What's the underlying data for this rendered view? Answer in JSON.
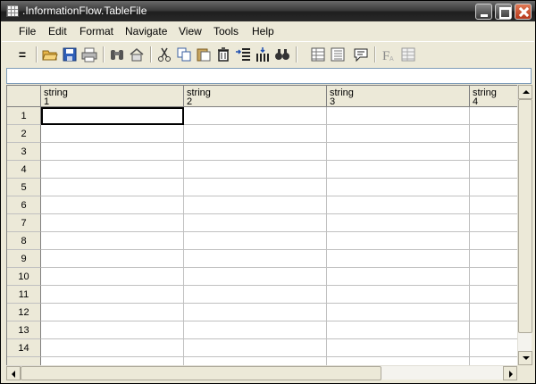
{
  "window": {
    "title": ".InformationFlow.TableFile"
  },
  "menu": [
    "File",
    "Edit",
    "Format",
    "Navigate",
    "View",
    "Tools",
    "Help"
  ],
  "toolbar": {
    "icons": [
      "equals-icon",
      "open-folder-icon",
      "save-icon",
      "print-icon",
      "binoculars-icon",
      "home-icon",
      "cut-icon",
      "copy-icon",
      "paste-icon",
      "delete-icon",
      "insert-row-icon",
      "insert-column-icon",
      "find-icon",
      "table-view-icon",
      "list-view-icon",
      "comment-icon",
      "font-icon",
      "grid-settings-icon"
    ],
    "equals_label": "="
  },
  "formula_bar": {
    "value": ""
  },
  "grid": {
    "columns": [
      {
        "type": "string",
        "index": "1"
      },
      {
        "type": "string",
        "index": "2"
      },
      {
        "type": "string",
        "index": "3"
      },
      {
        "type": "string",
        "index": "4"
      }
    ],
    "rows": [
      "1",
      "2",
      "3",
      "4",
      "5",
      "6",
      "7",
      "8",
      "9",
      "10",
      "11",
      "12",
      "13",
      "14"
    ],
    "active_cell": {
      "row": 1,
      "column": 1
    }
  }
}
